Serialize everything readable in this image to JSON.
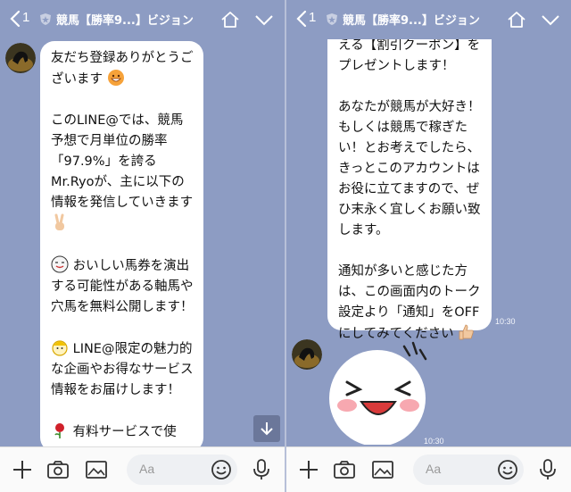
{
  "header": {
    "unread_count": "1",
    "title": "競馬【勝率9...】ビジョン"
  },
  "left": {
    "paragraphs": [
      "友だち登録ありがとうございます",
      "このLINE@では、競馬予想で月単位の勝率「97.9%」を誇るMr.Ryoが、主に以下の情報を発信していきます",
      "おいしい馬券を演出する可能性がある軸馬や穴馬を無料公開します！",
      "LINE@限定の魅力的な企画やお得なサービス情報をお届けします！",
      "有料サービスで使"
    ]
  },
  "right": {
    "paragraphs": [
      "える【割引クーポン】をプレゼントします！",
      "あなたが競馬が大好き！もしくは競馬で稼ぎたい！とお考えでしたら、きっとこのアカウントはお役に立てますので、ぜひ末永く宜しくお願い致します。",
      "通知が多いと感じた方は、この画面内のトーク設定より「通知」をOFFにしてみてください"
    ],
    "time1": "10:30",
    "time2": "10:30"
  },
  "input": {
    "placeholder": "Aa"
  },
  "colors": {
    "background": "#8d9cc3",
    "bubble": "#ffffff",
    "input_bar": "#fafafa"
  },
  "icons": [
    "back-chevron-icon",
    "shield-icon",
    "home-icon",
    "chevron-down-icon",
    "plus-icon",
    "camera-icon",
    "image-icon",
    "smile-icon",
    "mic-icon",
    "arrow-down-icon"
  ]
}
